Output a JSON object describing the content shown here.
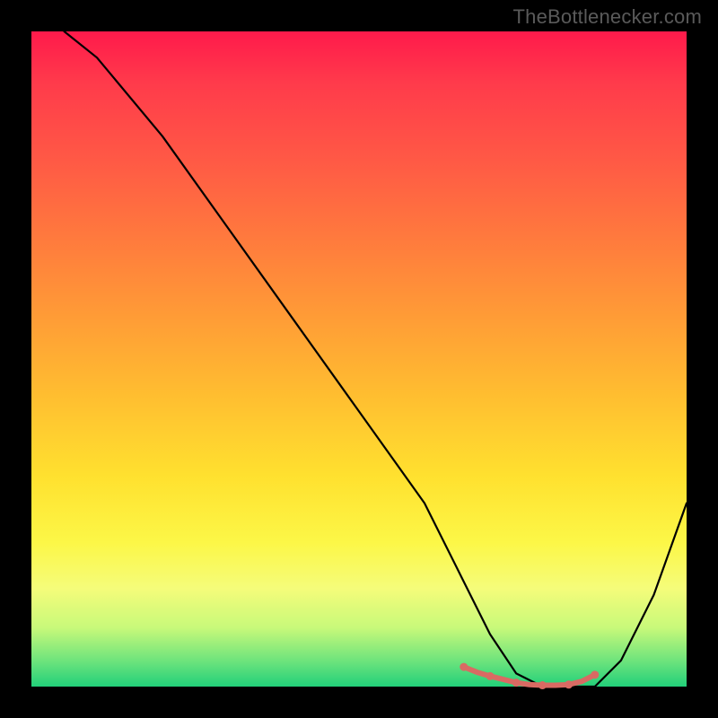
{
  "brand": {
    "label": "TheBottlenecker.com"
  },
  "chart_data": {
    "type": "line",
    "title": "",
    "xlabel": "",
    "ylabel": "",
    "xlim": [
      0,
      100
    ],
    "ylim": [
      0,
      100
    ],
    "grid": false,
    "series": [
      {
        "name": "bottleneck-curve",
        "color": "#000000",
        "stroke_width": 2.2,
        "x": [
          5,
          10,
          20,
          30,
          40,
          50,
          60,
          66,
          70,
          74,
          78,
          82,
          86,
          90,
          95,
          100
        ],
        "values": [
          100,
          96,
          84,
          70,
          56,
          42,
          28,
          16,
          8,
          2,
          0,
          0,
          0,
          4,
          14,
          28
        ]
      },
      {
        "name": "optimal-zone",
        "color": "#d96a63",
        "stroke_width": 6,
        "x": [
          66,
          68,
          70,
          72,
          74,
          76,
          78,
          80,
          82,
          84,
          86
        ],
        "values": [
          3,
          2.2,
          1.6,
          1.1,
          0.6,
          0.3,
          0.2,
          0.2,
          0.3,
          0.8,
          1.8
        ]
      }
    ],
    "markers": {
      "color": "#d96a63",
      "radius": 4.5,
      "x": [
        66,
        70,
        74,
        78,
        82,
        86
      ],
      "values": [
        3,
        1.6,
        0.6,
        0.2,
        0.3,
        1.8
      ]
    }
  }
}
